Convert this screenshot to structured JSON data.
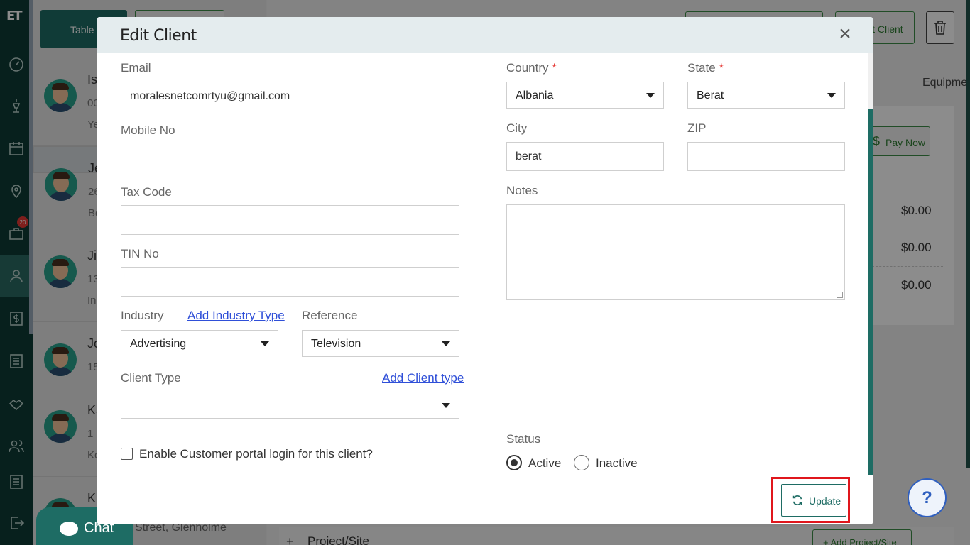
{
  "sidebar": {
    "logo": "ET",
    "badge_count": "20",
    "items": [
      "dashboard-icon",
      "lamp-icon",
      "calendar-icon",
      "map-pin-icon",
      "briefcase-icon",
      "user-icon",
      "dollar-icon",
      "list-icon",
      "handshake-icon",
      "users-icon",
      "sliders-icon",
      "logout-icon"
    ]
  },
  "background": {
    "table_view_label": "Table V",
    "clients": [
      {
        "name": "Is",
        "line2": "00",
        "line3": "Ye"
      },
      {
        "name": "Je",
        "line2": "26",
        "line3": "Be"
      },
      {
        "name": "Ji",
        "line2": "13",
        "line3": "In"
      },
      {
        "name": "Jo",
        "line2": "15",
        "line3": ""
      },
      {
        "name": "Ka",
        "line2": "1",
        "line3": "Ko"
      },
      {
        "name": "Ki",
        "line2": "",
        "line3": ""
      }
    ],
    "edit_client_label": "it Client",
    "equipment_label": "Equipme",
    "pay_now_label": "Pay Now",
    "amounts": [
      "$0.00",
      "$0.00",
      "$0.00"
    ],
    "chat_label": "Chat",
    "address_snippet": "Street, Glenholme",
    "project_site_label": "Project/Site",
    "add_project_label": "Add Project/Site",
    "help_label": "?"
  },
  "modal": {
    "title": "Edit Client",
    "close_label": "×",
    "email": {
      "label": "Email",
      "value": "moralesnetcomrtyu@gmail.com"
    },
    "mobile": {
      "label": "Mobile No",
      "value": ""
    },
    "tax_code": {
      "label": "Tax Code",
      "value": ""
    },
    "tin_no": {
      "label": "TIN No",
      "value": ""
    },
    "industry": {
      "label": "Industry",
      "add_link": "Add Industry Type",
      "value": "Advertising"
    },
    "reference": {
      "label": "Reference",
      "value": "Television"
    },
    "client_type": {
      "label": "Client Type",
      "add_link": "Add Client type",
      "value": ""
    },
    "portal_checkbox_label": "Enable Customer portal login for this client?",
    "country": {
      "label": "Country",
      "required": "*",
      "value": "Albania"
    },
    "state": {
      "label": "State",
      "required": "*",
      "value": "Berat"
    },
    "city": {
      "label": "City",
      "value": "berat"
    },
    "zip": {
      "label": "ZIP",
      "value": ""
    },
    "notes": {
      "label": "Notes",
      "value": ""
    },
    "status": {
      "label": "Status",
      "active_label": "Active",
      "inactive_label": "Inactive",
      "selected": "Active"
    },
    "update_label": "Update"
  },
  "colors": {
    "brand_dark": "#0d3b36",
    "brand": "#1e6c64",
    "link": "#2f4fd8",
    "required": "#e53935",
    "highlight": "#e0161c"
  }
}
